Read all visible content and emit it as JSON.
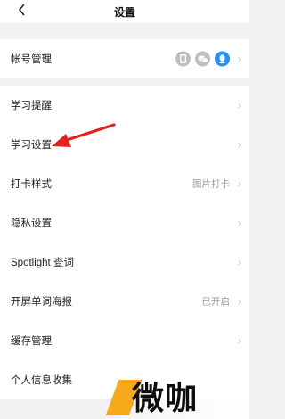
{
  "header": {
    "back_icon": "chevron-left-icon",
    "title": "设置"
  },
  "groups": [
    {
      "rows": [
        {
          "label": "帐号管理",
          "bound_accounts": [
            "phone-icon",
            "wechat-icon",
            "qq-icon"
          ]
        }
      ]
    },
    {
      "rows": [
        {
          "label": "学习提醒"
        },
        {
          "label": "学习设置"
        },
        {
          "label": "打卡样式",
          "value": "图片打卡"
        },
        {
          "label": "隐私设置"
        },
        {
          "label": "Spotlight 查词"
        },
        {
          "label": "开屏单词海报",
          "value": "已开启"
        },
        {
          "label": "缓存管理"
        },
        {
          "label": "个人信息收集"
        }
      ]
    }
  ],
  "chevron": "›",
  "annotation": {
    "arrow_color": "#e8211f"
  },
  "watermark": {
    "text": "微咖",
    "accent_color": "#f7a81b"
  }
}
